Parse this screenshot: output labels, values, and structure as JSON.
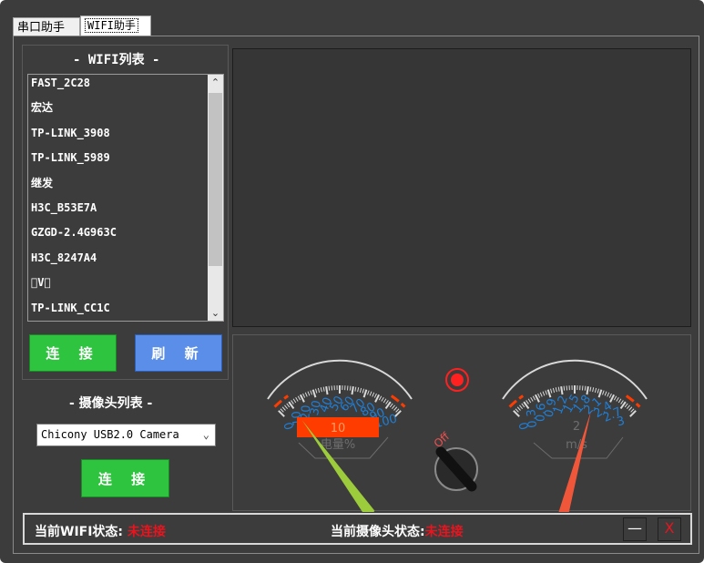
{
  "tabs": [
    {
      "label": "串口助手"
    },
    {
      "label": "WIFI助手"
    }
  ],
  "wifi": {
    "title": "- WIFI列表 -",
    "networks": [
      "FAST_2C28",
      "宏达",
      "TP-LINK_3908",
      "TP-LINK_5989",
      "继发",
      "H3C_B53E7A",
      "GZGD-2.4G963C",
      "H3C_8247A4",
      "\u0000V\u0000",
      "TP-LINK_CC1C"
    ],
    "connect_label": "连 接",
    "refresh_label": "刷 新"
  },
  "camera": {
    "title": "- 摄像头列表 -",
    "selected": "Chicony USB2.0 Camera",
    "connect_label": "连 接"
  },
  "gauge_battery": {
    "ticks": [
      "0",
      "10",
      "20",
      "30",
      "40",
      "50",
      "60",
      "70",
      "80",
      "90",
      "100"
    ],
    "value": "10",
    "unit": "电量%",
    "level": 10
  },
  "switch": {
    "label": "Off"
  },
  "gauge_speed": {
    "ticks": [
      "0",
      "0.3",
      "0.6",
      "0.9",
      "1.2",
      "1.5",
      "1.8",
      "2.1",
      "2.4",
      "2.7",
      "3"
    ],
    "value": "2",
    "unit": "m/s",
    "level": 2
  },
  "status": {
    "wifi_label": "当前WIFI状态:",
    "wifi_value": "未连接",
    "camera_label": "当前摄像头状态:",
    "camera_value": "未连接",
    "minimize_label": "—",
    "close_label": "X"
  },
  "colors": {
    "green_button": "#2fc43f",
    "blue_button": "#5a8ee8",
    "battery_needle": "#9ccb3c",
    "speed_needle": "#f0573a",
    "tick_text": "#1e7fd8",
    "status_red": "#e8141e"
  }
}
